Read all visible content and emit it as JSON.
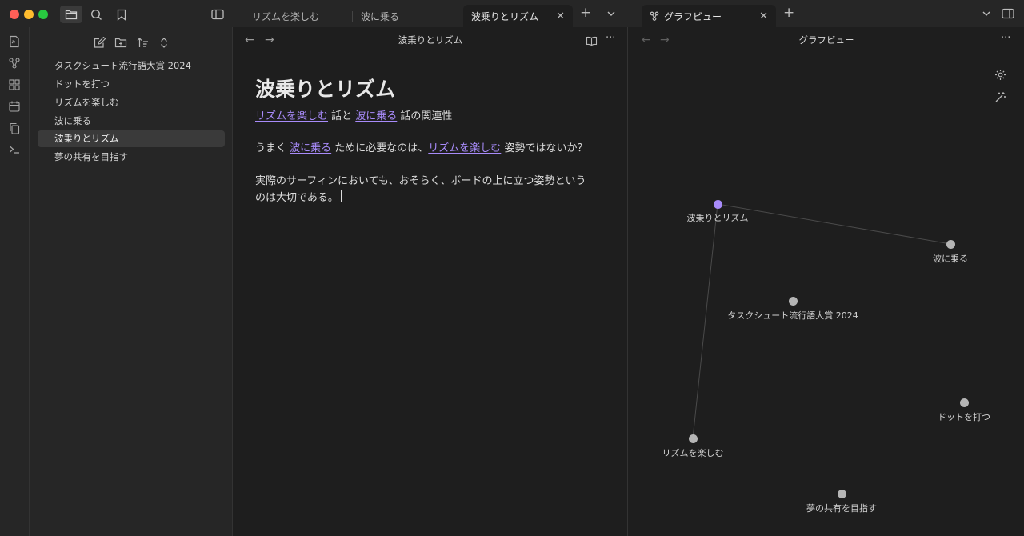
{
  "tabs": [
    {
      "label": "リズムを楽しむ"
    },
    {
      "label": "波に乗る"
    },
    {
      "label": "波乗りとリズム",
      "active": true
    },
    {
      "label": "グラフビュー",
      "active": true
    }
  ],
  "tab_close_glyph": "✕",
  "tab_add_glyph": "+",
  "sidebar": {
    "files": [
      {
        "label": "タスクシュート流行語大賞 2024"
      },
      {
        "label": "ドットを打つ"
      },
      {
        "label": "リズムを楽しむ"
      },
      {
        "label": "波に乗る"
      },
      {
        "label": "波乗りとリズム",
        "active": true
      },
      {
        "label": "夢の共有を目指す"
      }
    ]
  },
  "editor": {
    "header_title": "波乗りとリズム",
    "nav_back": "←",
    "nav_forward": "→",
    "more": "···",
    "note_title": "波乗りとリズム",
    "p1": {
      "link1": "リズムを楽しむ",
      "mid": " 話と ",
      "link2": "波に乗る",
      "tail": " 話の関連性"
    },
    "p2": {
      "head": "うまく ",
      "link1": "波に乗る",
      "mid": " ために必要なのは、",
      "link2": "リズムを楽しむ",
      "tail": " 姿勢ではないか？"
    },
    "p3": {
      "line1": "実際のサーフィンにおいても、おそらく、ボードの上に立つ姿勢という",
      "line2": "のは大切である。"
    }
  },
  "graph": {
    "header_title": "グラフビュー",
    "nav_back": "←",
    "nav_forward": "→",
    "more": "···",
    "nodes": [
      {
        "label": "波乗りとリズム",
        "active": true
      },
      {
        "label": "波に乗る"
      },
      {
        "label": "タスクシュート流行語大賞 2024"
      },
      {
        "label": "ドットを打つ"
      },
      {
        "label": "リズムを楽しむ"
      },
      {
        "label": "夢の共有を目指す"
      }
    ],
    "edges": [
      [
        0,
        1
      ],
      [
        0,
        4
      ]
    ]
  },
  "icons": {
    "titlebar": [
      "folder-icon",
      "search-icon",
      "bookmark-icon",
      "sidebar-toggle-icon"
    ],
    "ribbon": [
      "open-quick-switcher-icon",
      "graph-icon",
      "canvas-icon",
      "calendar-icon",
      "copy-icon",
      "terminal-icon"
    ],
    "sidebar_tools": [
      "new-note-icon",
      "new-folder-icon",
      "sort-icon",
      "collapse-icon"
    ]
  },
  "colors": {
    "accent": "#a88bfa",
    "node": "#b5b5b5",
    "bg": "#1e1e1e",
    "panel": "#262626"
  }
}
